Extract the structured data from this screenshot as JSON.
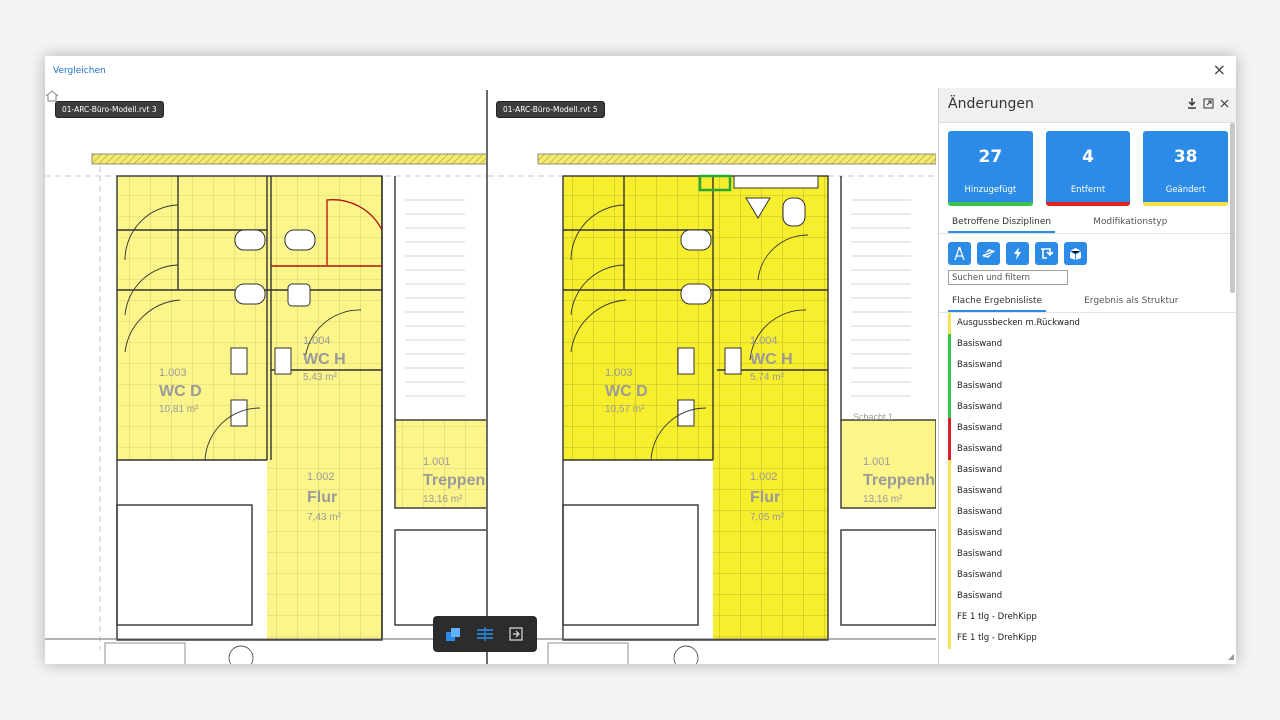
{
  "modal": {
    "title": "Vergleichen",
    "close": "×"
  },
  "viewers": {
    "left": {
      "label": "01-ARC-Büro-Modell.rvt 3",
      "rooms": [
        {
          "num": "1.003",
          "name": "WC D",
          "area": "10,81 m²"
        },
        {
          "num": "1.004",
          "name": "WC H",
          "area": "5,43 m²"
        },
        {
          "num": "1.002",
          "name": "Flur",
          "area": "7,43 m²"
        },
        {
          "num": "1.001",
          "name": "Treppen",
          "area": "13,16 m²"
        }
      ]
    },
    "right": {
      "label": "01-ARC-Büro-Modell.rvt 5",
      "rooms": [
        {
          "num": "1.003",
          "name": "WC D",
          "area": "10,57 m²"
        },
        {
          "num": "1.004",
          "name": "WC H",
          "area": "5,74 m²"
        },
        {
          "num": "1.002",
          "name": "Flur",
          "area": "7,05 m²"
        },
        {
          "num": "1.001",
          "name": "Treppenh",
          "area": "13,16 m²"
        },
        {
          "num": "",
          "name": "Schacht 1",
          "area": ""
        }
      ]
    }
  },
  "panel": {
    "title": "Änderungen",
    "stats": [
      {
        "value": "27",
        "label": "Hinzugefügt",
        "color": "#3cc44a"
      },
      {
        "value": "4",
        "label": "Entfernt",
        "color": "#e02424"
      },
      {
        "value": "38",
        "label": "Geändert",
        "color": "#f2e14a"
      }
    ],
    "tabs1": [
      "Betroffene Disziplinen",
      "Modifikationstyp"
    ],
    "tabs2": [
      "Flache Ergebnisliste",
      "Ergebnis als Struktur"
    ],
    "search_placeholder": "Suchen und filtern",
    "disciplines": [
      "architecture-icon",
      "structure-icon",
      "electrical-icon",
      "plumbing-icon",
      "mechanical-icon"
    ],
    "results": [
      {
        "label": "Ausgussbecken m.Rückwand",
        "color": "#f7e35a"
      },
      {
        "label": "Basiswand",
        "color": "#3cc44a"
      },
      {
        "label": "Basiswand",
        "color": "#3cc44a"
      },
      {
        "label": "Basiswand",
        "color": "#3cc44a"
      },
      {
        "label": "Basiswand",
        "color": "#3cc44a"
      },
      {
        "label": "Basiswand",
        "color": "#d81f26"
      },
      {
        "label": "Basiswand",
        "color": "#d81f26"
      },
      {
        "label": "Basiswand",
        "color": "#f7e35a"
      },
      {
        "label": "Basiswand",
        "color": "#f7e35a"
      },
      {
        "label": "Basiswand",
        "color": "#f7e35a"
      },
      {
        "label": "Basiswand",
        "color": "#f7e35a"
      },
      {
        "label": "Basiswand",
        "color": "#f7e35a"
      },
      {
        "label": "Basiswand",
        "color": "#f7e35a"
      },
      {
        "label": "Basiswand",
        "color": "#f7e35a"
      },
      {
        "label": "FE 1 tlg - DrehKipp",
        "color": "#f7e35a"
      },
      {
        "label": "FE 1 tlg - DrehKipp",
        "color": "#f7e35a"
      }
    ]
  },
  "colors": {
    "accent": "#2b8be6",
    "highlight": "#f7f07a",
    "added": "#3cc44a",
    "removed": "#e02424",
    "modified": "#f2e14a"
  }
}
